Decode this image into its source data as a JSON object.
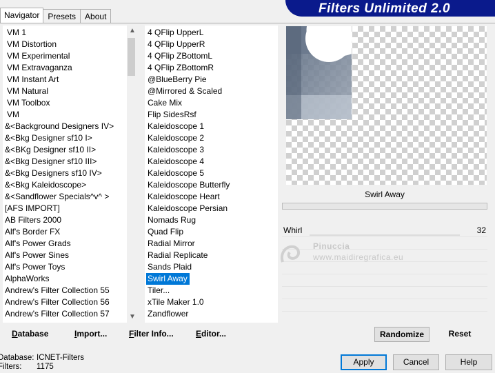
{
  "tabs": [
    "Navigator",
    "Presets",
    "About"
  ],
  "banner": {
    "title": "Filters Unlimited 2.0"
  },
  "categories": [
    "VM 1",
    "VM Distortion",
    "VM Experimental",
    "VM Extravaganza",
    "VM Instant Art",
    "VM Natural",
    "VM Toolbox",
    "VM",
    "&<Background Designers IV>",
    "&<Bkg Designer sf10 I>",
    "&<BKg Designer sf10 II>",
    "&<Bkg Designer sf10 III>",
    "&<Bkg Designers sf10 IV>",
    "&<Bkg Kaleidoscope>",
    "&<Sandflower Specials^v^ >",
    "[AFS IMPORT]",
    "AB Filters 2000",
    "Alf's Border FX",
    "Alf's Power Grads",
    "Alf's Power Sines",
    "Alf's Power Toys",
    "AlphaWorks",
    "Andrew's Filter Collection 55",
    "Andrew's Filter Collection 56",
    "Andrew's Filter Collection 57"
  ],
  "filters": [
    "4 QFlip UpperL",
    "4 QFlip UpperR",
    "4 QFlip ZBottomL",
    "4 QFlip ZBottomR",
    "@BlueBerry Pie",
    "@Mirrored & Scaled",
    "Cake Mix",
    "Flip SidesRsf",
    "Kaleidoscope 1",
    "Kaleidoscope 2",
    "Kaleidoscope 3",
    "Kaleidoscope 4",
    "Kaleidoscope 5",
    "Kaleidoscope Butterfly",
    "Kaleidoscope Heart",
    "Kaleidoscope Persian",
    "Nomads Rug",
    "Quad Flip",
    "Radial Mirror",
    "Radial Replicate",
    "Sands Plaid",
    "Swirl Away",
    "Tiler...",
    "xTile Maker 1.0",
    "Zandflower"
  ],
  "selected_filter_index": 21,
  "preview": {
    "filter_name": "Swirl Away"
  },
  "params": [
    {
      "label": "Whirl",
      "value": "32"
    }
  ],
  "toolbar": {
    "database": "Database",
    "import": "Import...",
    "filter_info": "Filter Info...",
    "editor": "Editor...",
    "randomize": "Randomize",
    "reset": "Reset"
  },
  "status": {
    "database_key": "Database:",
    "database_value": "ICNET-Filters",
    "filters_key": "Filters:",
    "filters_value": "1175"
  },
  "buttons": {
    "apply": "Apply",
    "cancel": "Cancel",
    "help": "Help"
  },
  "watermark": {
    "line1": "Pinuccia",
    "line2": "www.maidiregrafica.eu"
  },
  "colors": {
    "banner": "#0a1a8c",
    "selection": "#0078d7"
  }
}
